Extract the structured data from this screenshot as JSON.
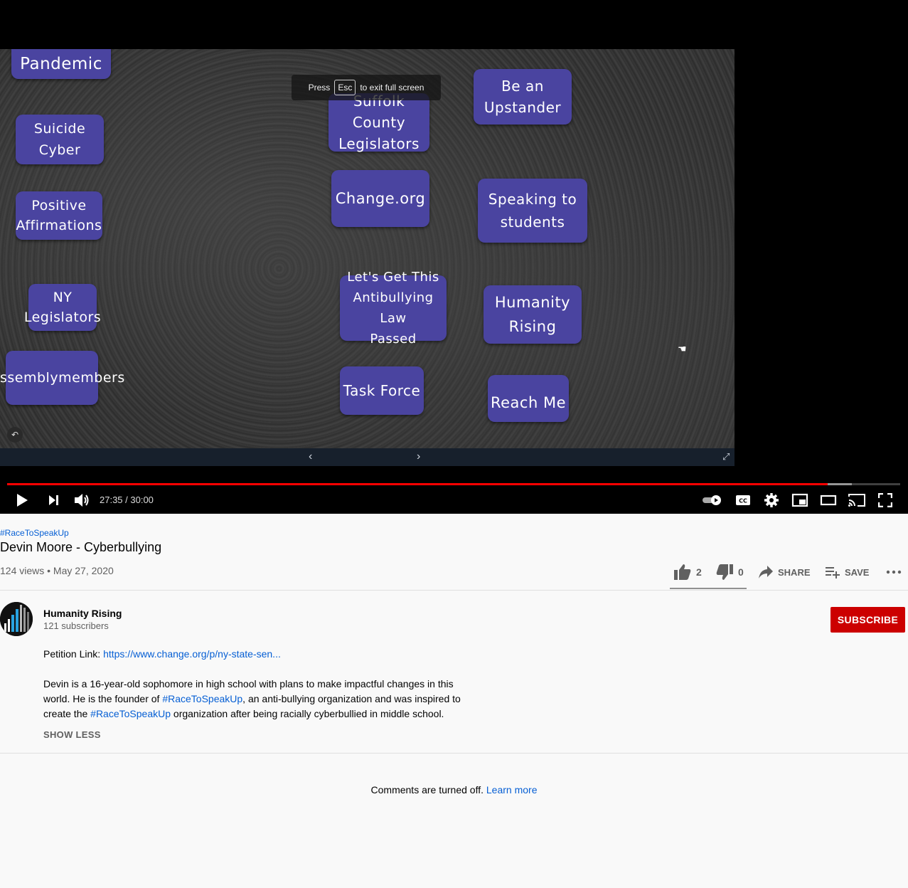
{
  "player": {
    "esc_toast": {
      "press": "Press",
      "key": "Esc",
      "rest": "to exit full screen"
    },
    "slide_notes": [
      "Pandemic",
      "Suicide Cyber",
      "Positive\nAffirmations",
      "NY\nLegislators",
      "ssemblymembers",
      "Suffolk County\nLegislators",
      "Change.org",
      "Let's Get This\nAntibullying Law\nPassed",
      "Task Force",
      "Be an\nUpstander",
      "Speaking to\nstudents",
      "Humanity\nRising",
      "Reach Me"
    ],
    "time": "27:35 / 30:00",
    "progress_played": 0.919,
    "progress_buffered": 0.946,
    "icons": {
      "play": "play-icon",
      "next": "next-icon",
      "volume": "volume-icon",
      "autoplay": "autoplay-toggle-icon",
      "captions": "captions-icon",
      "settings": "gear-icon",
      "miniplayer": "miniplayer-icon",
      "theater": "theater-mode-icon",
      "cast": "cast-icon",
      "fullscreen": "fullscreen-icon"
    },
    "colors": {
      "played": "#ff0000",
      "note_bg": "#4a44a0"
    }
  },
  "video": {
    "hashtag": "#RaceToSpeakUp",
    "title": "Devin Moore - Cyberbullying",
    "views_date": "124 views • May 27, 2020",
    "likes": "2",
    "dislikes": "0",
    "share_label": "SHARE",
    "save_label": "SAVE"
  },
  "channel": {
    "name": "Humanity Rising",
    "subscribers": "121 subscribers",
    "subscribe_label": "SUBSCRIBE"
  },
  "description": {
    "petition_prefix": "Petition Link: ",
    "petition_url": "https://www.change.org/p/ny-state-sen...",
    "p1": "Devin is a 16-year-old sophomore in high school with plans to make impactful changes in this world. He is the founder of ",
    "hashtag": "#RaceToSpeakUp",
    "p2": ", an anti-bullying organization and was inspired to create the ",
    "p3": " organization after being racially cyberbullied in middle school.",
    "show_less": "SHOW LESS"
  },
  "comments": {
    "off_text": "Comments are turned off. ",
    "learn_more": "Learn more"
  }
}
